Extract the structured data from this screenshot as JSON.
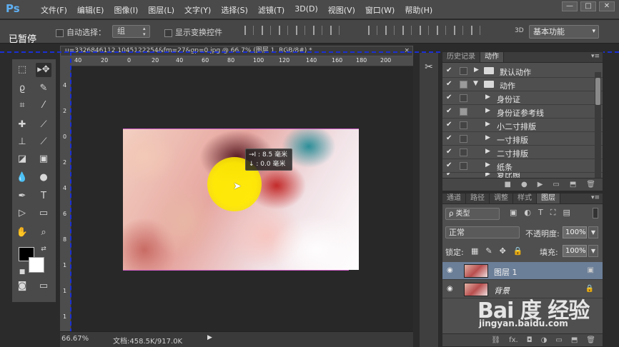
{
  "app": {
    "logo": "Ps",
    "menus": [
      "文件(F)",
      "编辑(E)",
      "图像(I)",
      "图层(L)",
      "文字(Y)",
      "选择(S)",
      "滤镜(T)",
      "3D(D)",
      "视图(V)",
      "窗口(W)",
      "帮助(H)"
    ],
    "window_controls": [
      "—",
      "□",
      "✕"
    ]
  },
  "options": {
    "paused_label": "已暂停",
    "auto_select_label": "自动选择：",
    "auto_select_value": "组",
    "show_transform_label": "显示变换控件",
    "label_3d": "3D",
    "workspace": "基本功能"
  },
  "document": {
    "tab_title": "u=3326846112,1045122254&fm=27&gp=0.jpg @ 66.7% (图层 1, RGB/8#) *",
    "tab_close": "×",
    "ruler_h_ticks": [
      "40",
      "20",
      "0",
      "20",
      "40",
      "60",
      "80",
      "100",
      "120",
      "140",
      "160",
      "180",
      "200"
    ],
    "ruler_v_ticks": [
      "4",
      "2",
      "0",
      "2",
      "4",
      "6",
      "8",
      "1",
      "1",
      "1"
    ],
    "tooltip_line1": "→I : 8.5 毫米",
    "tooltip_line2": "↓ : 0.0 毫米",
    "zoom": "66.67%",
    "doc_size": "文档:458.5K/917.0K",
    "status_arrow": "▶"
  },
  "actions_panel": {
    "tabs": [
      "历史记录",
      "动作"
    ],
    "active_tab": "动作",
    "menu_icon": "▾≡",
    "rows": [
      {
        "name": "默认动作",
        "level": 0,
        "folder": true,
        "expanded": false,
        "box_filled": false
      },
      {
        "name": "动作",
        "level": 0,
        "folder": true,
        "expanded": true,
        "box_filled": true
      },
      {
        "name": "身份证",
        "level": 1,
        "folder": false,
        "expanded": false,
        "box_filled": false
      },
      {
        "name": "身份证参考线",
        "level": 1,
        "folder": false,
        "expanded": false,
        "box_filled": true
      },
      {
        "name": "小二寸排版",
        "level": 1,
        "folder": false,
        "expanded": false,
        "box_filled": false
      },
      {
        "name": "一寸排版",
        "level": 1,
        "folder": false,
        "expanded": false,
        "box_filled": false
      },
      {
        "name": "二寸排版",
        "level": 1,
        "folder": false,
        "expanded": false,
        "box_filled": false
      },
      {
        "name": "纸条",
        "level": 1,
        "folder": false,
        "expanded": false,
        "box_filled": false
      },
      {
        "name": "复比照",
        "level": 1,
        "folder": false,
        "expanded": false,
        "box_filled": false
      }
    ],
    "footer_icons": [
      "■",
      "●",
      "▶",
      "▭",
      "⬒",
      "🗑"
    ]
  },
  "layers_panel": {
    "tabs": [
      "通道",
      "路径",
      "调整",
      "样式",
      "图层"
    ],
    "active_tab": "图层",
    "menu_icon": "▾≡",
    "filter_label": "ρ 类型",
    "filter_icons": [
      "▣",
      "◐",
      "T",
      "⛶",
      "▤"
    ],
    "blend_mode": "正常",
    "opacity_label": "不透明度:",
    "opacity_value": "100%",
    "lock_label": "锁定:",
    "lock_icons": [
      "▦",
      "✎",
      "✥",
      "🔒"
    ],
    "fill_label": "填充:",
    "fill_value": "100%",
    "layers": [
      {
        "name": "图层 1",
        "selected": true,
        "italic": false
      },
      {
        "name": "背景",
        "selected": false,
        "italic": true
      }
    ],
    "footer_icons": [
      "⛓",
      "fx.",
      "◘",
      "◑",
      "▭",
      "⬒",
      "🗑"
    ]
  },
  "watermark": {
    "logo_text": "Bai 度 经验",
    "url": "jingyan.baidu.com"
  }
}
